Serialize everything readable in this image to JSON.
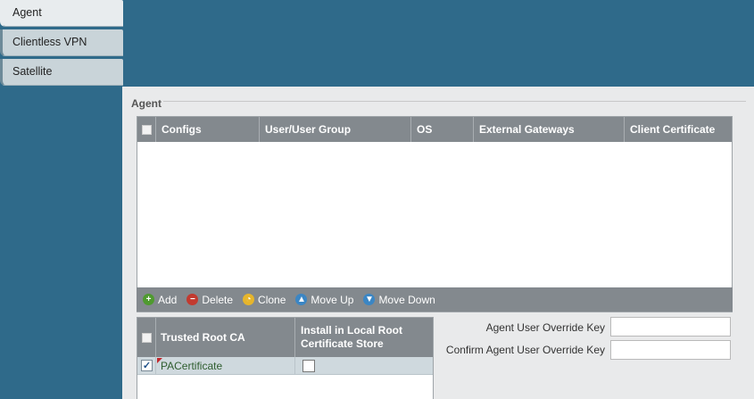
{
  "tabs": [
    {
      "label": "Agent",
      "active": true
    },
    {
      "label": "Clientless VPN",
      "active": false
    },
    {
      "label": "Satellite",
      "active": false
    }
  ],
  "section": {
    "title": "Agent"
  },
  "grid": {
    "columns": [
      "Configs",
      "User/User Group",
      "OS",
      "External Gateways",
      "Client Certificate"
    ]
  },
  "toolbar": {
    "add": "Add",
    "delete": "Delete",
    "clone": "Clone",
    "move_up": "Move Up",
    "move_down": "Move Down"
  },
  "ca_table": {
    "col_name": "Trusted Root CA",
    "col_install_line1": "Install in Local Root",
    "col_install_line2": "Certificate Store",
    "rows": [
      {
        "name": "PACertificate",
        "selected": true,
        "install": false
      }
    ]
  },
  "form": {
    "override_key_label": "Agent User Override Key",
    "override_key_value": "",
    "confirm_key_label": "Confirm Agent User Override Key",
    "confirm_key_value": ""
  },
  "colors": {
    "background": "#2f6a8a",
    "header": "#83898e",
    "row_selected": "#cfd9de"
  }
}
